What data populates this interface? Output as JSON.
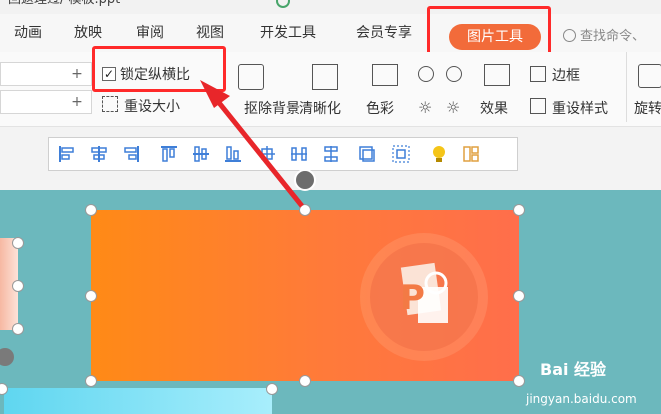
{
  "title_bar": {
    "doc_tab": "回返理过/ 模板.ppt"
  },
  "tabs": [
    {
      "label": "动画"
    },
    {
      "label": "放映"
    },
    {
      "label": "审阅"
    },
    {
      "label": "视图"
    },
    {
      "label": "开发工具"
    },
    {
      "label": "会员专享"
    },
    {
      "label": "图片工具",
      "active": true
    }
  ],
  "search": {
    "placeholder": "查找命令、"
  },
  "ribbon": {
    "lock_ratio": {
      "label": "锁定纵横比",
      "checked": true
    },
    "reset_size": "重设大小",
    "remove_bg": "抠除背景",
    "sharpen": "清晰化",
    "color": "色彩",
    "border": "边框",
    "effects": "效果",
    "reset_style": "重设样式",
    "rotate": "旋转",
    "plus": "+"
  },
  "arrange_tools": [
    "align-left-icon",
    "align-center-icon",
    "align-right-icon",
    "align-top-icon",
    "align-middle-icon",
    "align-bottom-icon",
    "distribute-horizontal-icon",
    "distribute-horizontal-2-icon",
    "distribute-vertical-icon",
    "group-icon",
    "ungroup-icon",
    "hint-icon",
    "layout-icon"
  ],
  "watermark": {
    "brand": "Bai 经验",
    "domain": "jingyan.baidu.com"
  },
  "colors": {
    "accent": "#f26b3a",
    "highlight": "#ff2a2a",
    "slide_bg": "#6cb8bd",
    "picture": "#ff8a16"
  }
}
